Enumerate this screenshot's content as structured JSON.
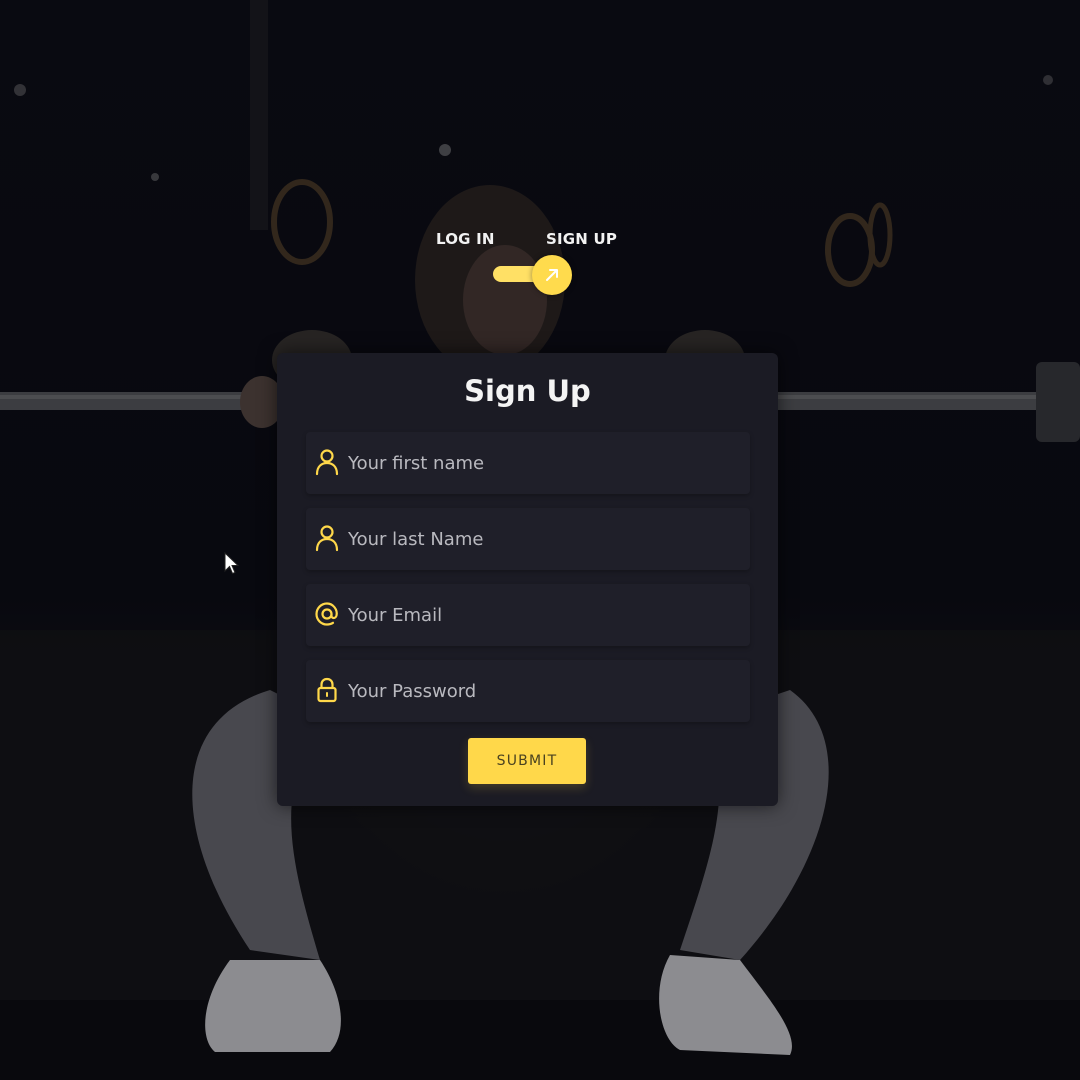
{
  "toggle": {
    "login_label": "LOG IN",
    "signup_label": "SIGN UP",
    "active": "SIGN UP",
    "accent_color": "#ffdb4d"
  },
  "form": {
    "title": "Sign Up",
    "fields": [
      {
        "icon": "user-icon",
        "placeholder": "Your first name",
        "value": ""
      },
      {
        "icon": "user-icon",
        "placeholder": "Your last Name",
        "value": ""
      },
      {
        "icon": "at-sign-icon",
        "placeholder": "Your Email",
        "value": ""
      },
      {
        "icon": "lock-icon",
        "placeholder": "Your Password",
        "value": ""
      }
    ],
    "submit_label": "SUBMIT"
  },
  "colors": {
    "accent": "#ffd84a",
    "card_background": "#1b1b24",
    "field_background": "#1f1f29",
    "page_background": "#0b0b10"
  }
}
